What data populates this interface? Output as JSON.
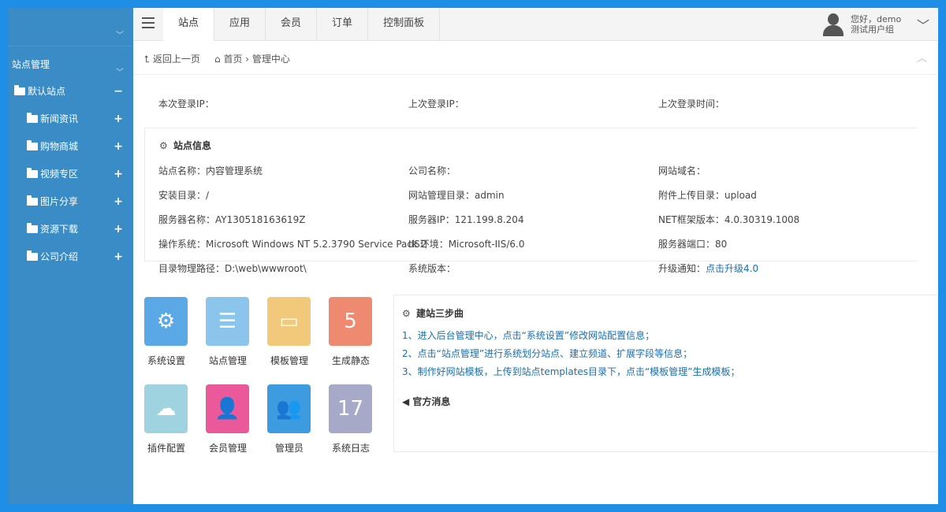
{
  "sidebar": {
    "title": "站点管理",
    "site": {
      "label": "默认站点",
      "sign": "−"
    },
    "items": [
      {
        "label": "新闻资讯",
        "sign": "+"
      },
      {
        "label": "购物商城",
        "sign": "+"
      },
      {
        "label": "视频专区",
        "sign": "+"
      },
      {
        "label": "图片分享",
        "sign": "+"
      },
      {
        "label": "资源下载",
        "sign": "+"
      },
      {
        "label": "公司介绍",
        "sign": "+"
      }
    ]
  },
  "topbar": {
    "tabs": [
      "站点",
      "应用",
      "会员",
      "订单",
      "控制面板"
    ],
    "active_tab": "站点",
    "user": {
      "greeting": "您好，demo",
      "group": "测试用户组"
    }
  },
  "breadcrumb": {
    "back": "返回上一页",
    "home": "首页",
    "current": "管理中心"
  },
  "login": {
    "this_ip_label": "本次登录IP：",
    "last_ip_label": "上次登录IP：",
    "last_time_label": "上次登录时间："
  },
  "site_info": {
    "title": "站点信息",
    "fields": [
      {
        "label": "站点名称：",
        "value": "内容管理系统"
      },
      {
        "label": "公司名称：",
        "value": ""
      },
      {
        "label": "网站域名：",
        "value": ""
      },
      {
        "label": "安装目录：",
        "value": "/"
      },
      {
        "label": "网站管理目录：",
        "value": "admin"
      },
      {
        "label": "附件上传目录：",
        "value": "upload"
      },
      {
        "label": "服务器名称：",
        "value": "AY130518163619Z"
      },
      {
        "label": "服务器IP：",
        "value": "121.199.8.204"
      },
      {
        "label": "NET框架版本：",
        "value": "4.0.30319.1008"
      },
      {
        "label": "操作系统：",
        "value": "Microsoft Windows NT 5.2.3790 Service Pack 2"
      },
      {
        "label": "IIS环境：",
        "value": "Microsoft-IIS/6.0"
      },
      {
        "label": "服务器端口：",
        "value": "80"
      },
      {
        "label": "目录物理路径：",
        "value": "D:\\web\\wwwroot\\"
      },
      {
        "label": "系统版本：",
        "value": ""
      },
      {
        "label": "升级通知：",
        "value": "点击升级4.0"
      }
    ]
  },
  "shortcuts": [
    {
      "label": "系统设置",
      "icon": "gear-icon",
      "color": "#5aa9e6"
    },
    {
      "label": "站点管理",
      "icon": "list-icon",
      "color": "#8cc5ec"
    },
    {
      "label": "模板管理",
      "icon": "template-icon",
      "color": "#f2c97a"
    },
    {
      "label": "生成静态",
      "icon": "html5-icon",
      "color": "#ee8a70"
    },
    {
      "label": "插件配置",
      "icon": "cloud-icon",
      "color": "#9fd3df"
    },
    {
      "label": "会员管理",
      "icon": "user-icon",
      "color": "#ea5a9b"
    },
    {
      "label": "管理员",
      "icon": "users-icon",
      "color": "#3d9be0"
    },
    {
      "label": "系统日志",
      "icon": "calendar-icon",
      "color": "#a7a9c9"
    }
  ],
  "steps": {
    "title": "建站三步曲",
    "items": [
      "1、进入后台管理中心，点击“系统设置”修改网站配置信息；",
      "2、点击“站点管理”进行系统划分站点、建立频道、扩展字段等信息；",
      "3、制作好网站模板，上传到站点templates目录下，点击“模板管理”生成模板；"
    ],
    "news_title": "官方消息"
  }
}
